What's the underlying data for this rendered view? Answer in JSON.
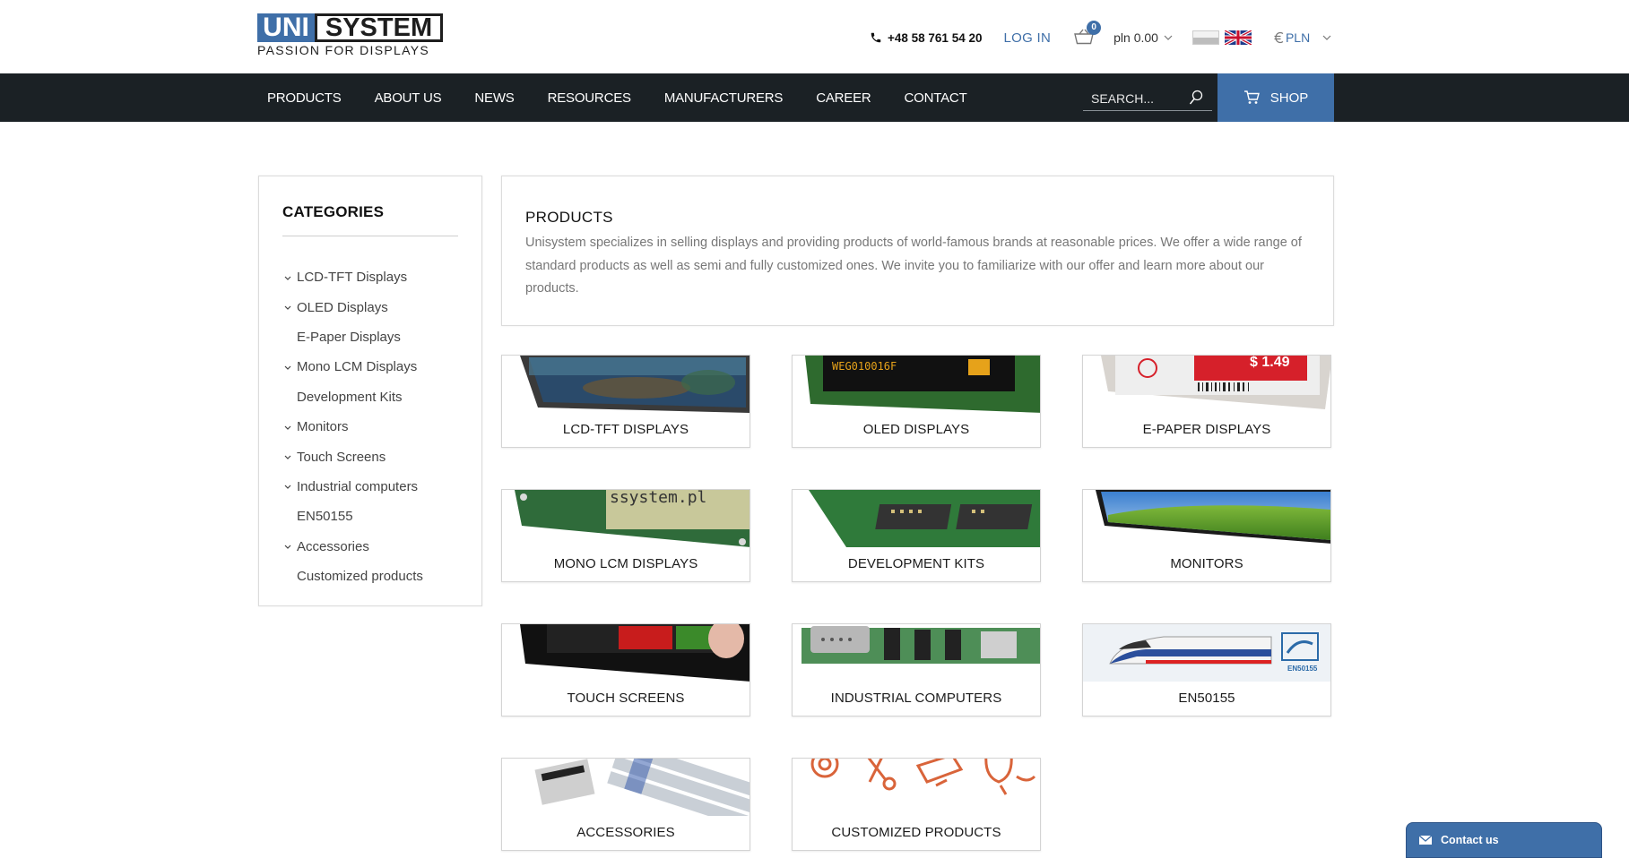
{
  "header": {
    "logo": {
      "uni": "UNI",
      "system": "SYSTEM",
      "tagline": "PASSION FOR DISPLAYS"
    },
    "phone": "+48 58 761 54 20",
    "login": "LOG IN",
    "cart_count": "0",
    "cart_total": "pln 0.00",
    "currency": "PLN"
  },
  "nav": {
    "items": [
      "PRODUCTS",
      "ABOUT US",
      "NEWS",
      "RESOURCES",
      "MANUFACTURERS",
      "CAREER",
      "CONTACT"
    ],
    "search_placeholder": "SEARCH...",
    "shop": "SHOP"
  },
  "sidebar": {
    "title": "CATEGORIES",
    "items": [
      {
        "label": "LCD-TFT Displays",
        "expandable": true
      },
      {
        "label": "OLED Displays",
        "expandable": true
      },
      {
        "label": "E-Paper Displays",
        "expandable": false
      },
      {
        "label": "Mono LCM Displays",
        "expandable": true
      },
      {
        "label": "Development Kits",
        "expandable": false
      },
      {
        "label": "Monitors",
        "expandable": true
      },
      {
        "label": "Touch Screens",
        "expandable": true
      },
      {
        "label": "Industrial computers",
        "expandable": true
      },
      {
        "label": "EN50155",
        "expandable": false
      },
      {
        "label": "Accessories",
        "expandable": true
      },
      {
        "label": "Customized products",
        "expandable": false
      }
    ]
  },
  "intro": {
    "title": "PRODUCTS",
    "text": "Unisystem specializes in selling displays and providing products of world-famous brands at reasonable prices. We offer a wide range of standard products as well as semi and fully customized ones. We invite you to familiarize with our offer and learn more about our products."
  },
  "products": [
    {
      "label": "LCD-TFT DISPLAYS",
      "image": "lcd-tft-image"
    },
    {
      "label": "OLED DISPLAYS",
      "image": "oled-image",
      "image_text": "WEG010016F"
    },
    {
      "label": "E-PAPER DISPLAYS",
      "image": "epaper-image",
      "image_text": "$ 1.49"
    },
    {
      "label": "MONO LCM DISPLAYS",
      "image": "mono-lcm-image",
      "image_text": "ssystem.pl"
    },
    {
      "label": "DEVELOPMENT KITS",
      "image": "devkit-image"
    },
    {
      "label": "MONITORS",
      "image": "monitor-image"
    },
    {
      "label": "TOUCH SCREENS",
      "image": "touchscreen-image"
    },
    {
      "label": "INDUSTRIAL COMPUTERS",
      "image": "industrial-pc-image"
    },
    {
      "label": "EN50155",
      "image": "train-image",
      "image_text": "EN50155"
    },
    {
      "label": "ACCESSORIES",
      "image": "cable-image"
    },
    {
      "label": "CUSTOMIZED PRODUCTS",
      "image": "tools-image"
    }
  ],
  "contact_widget": "Contact us",
  "colors": {
    "brand": "#3f6fa8",
    "nav_bg": "#1b2125",
    "text_muted": "#777777"
  }
}
